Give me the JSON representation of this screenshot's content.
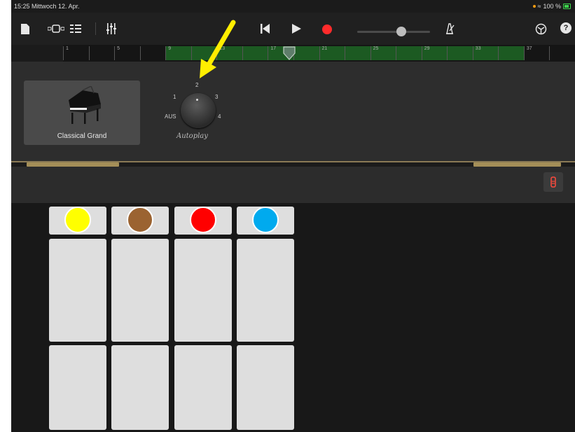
{
  "status": {
    "time_date": "15:25  Mittwoch 12. Apr.",
    "battery": "100 %"
  },
  "toolbar": {
    "icons": [
      "document-icon",
      "view-tracks-icon",
      "track-list-icon",
      "mixer-icon",
      "rewind-icon",
      "play-icon",
      "record-icon",
      "metronome-icon",
      "settings-icon",
      "help-icon"
    ],
    "help_glyph": "?",
    "record_color": "#ff2b2b",
    "volume_level": 0.6
  },
  "ruler": {
    "bars": [
      "1",
      "5",
      "9",
      "13",
      "17",
      "21",
      "25",
      "29",
      "33",
      "37"
    ],
    "green_section_color": "#1c5a22"
  },
  "instrument": {
    "name": "Classical Grand"
  },
  "autoplay": {
    "label": "Autoplay",
    "positions": [
      "AUS",
      "1",
      "2",
      "3",
      "4"
    ],
    "selected": "AUS"
  },
  "pads": {
    "colors": [
      "#ffff00",
      "#9b6331",
      "#ff0000",
      "#00aaee"
    ],
    "columns": 4,
    "rows": 3
  },
  "annotation": {
    "arrow_color": "#ffee00",
    "target": "Autoplay 2"
  }
}
